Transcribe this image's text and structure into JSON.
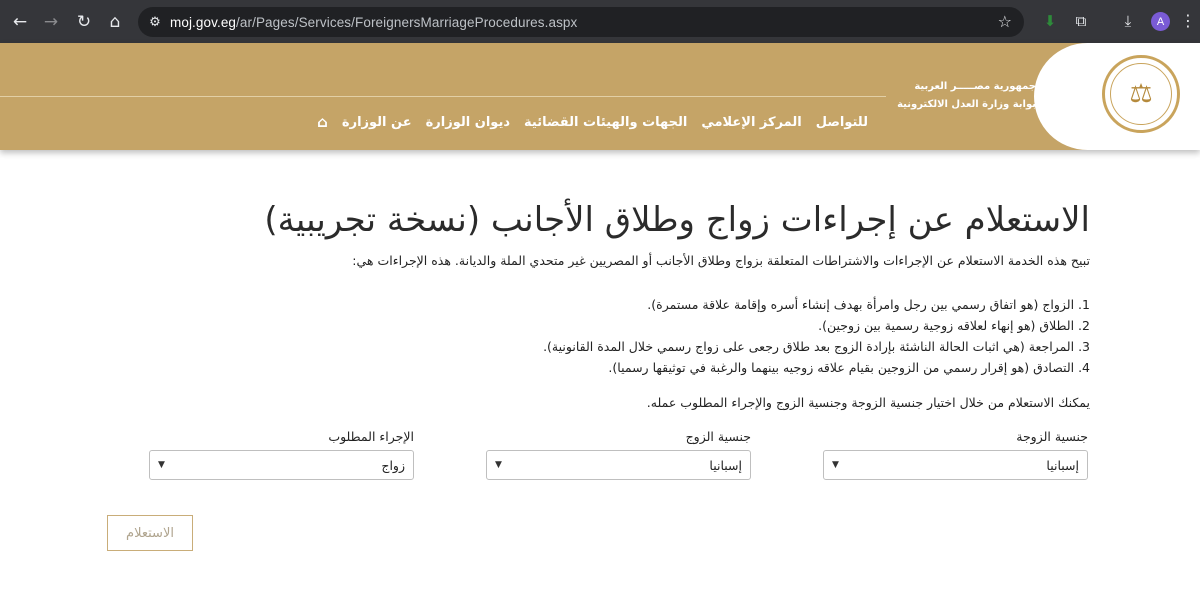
{
  "browser": {
    "url_host": "moj.gov.eg",
    "url_path": "/ar/Pages/Services/ForeignersMarriageProcedures.aspx",
    "profile_initial": "A"
  },
  "header": {
    "brand_line1": "جمهورية مصـــــر العربية",
    "brand_line2": "بوابة وزارة العدل الالكترونية",
    "nav": [
      {
        "label": "عن الوزارة"
      },
      {
        "label": "ديوان الوزارة"
      },
      {
        "label": "الجهات والهيئات القضائية"
      },
      {
        "label": "المركز الإعلامي"
      },
      {
        "label": "للتواصل"
      }
    ]
  },
  "main": {
    "title": "الاستعلام عن إجراءات زواج وطلاق الأجانب (نسخة تجريبية)",
    "intro": "تبيح هذه الخدمة الاستعلام عن الإجراءات والاشتراطات المتعلقة بزواج وطلاق الأجانب أو المصريين غير متحدي الملة والديانة. هذه الإجراءات هي:",
    "steps": [
      "1. الزواج (هو اتفاق رسمي بين رجل وامرأة بهدف إنشاء أسره وإقامة علاقة مستمرة).",
      "2. الطلاق (هو إنهاء لعلاقه زوجية رسمية بين زوجين).",
      "3. المراجعة (هي اثبات الحالة الناشئة بإرادة الزوج بعد طلاق رجعى على زواج رسمي خلال المدة القانونية).",
      "4. التصادق (هو إقرار رسمي من الزوجين بقيام علاقه زوجيه بينهما والرغبة في توثيقها رسميا)."
    ],
    "hint": "يمكنك الاستعلام من خلال اختيار جنسية الزوجة وجنسية الزوج والإجراء المطلوب عمله.",
    "fields": {
      "wife_label": "جنسية الزوجة",
      "wife_value": "إسبانيا",
      "husband_label": "جنسية الزوج",
      "husband_value": "إسبانيا",
      "procedure_label": "الإجراء المطلوب",
      "procedure_value": "زواج"
    },
    "submit_label": "الاستعلام"
  }
}
